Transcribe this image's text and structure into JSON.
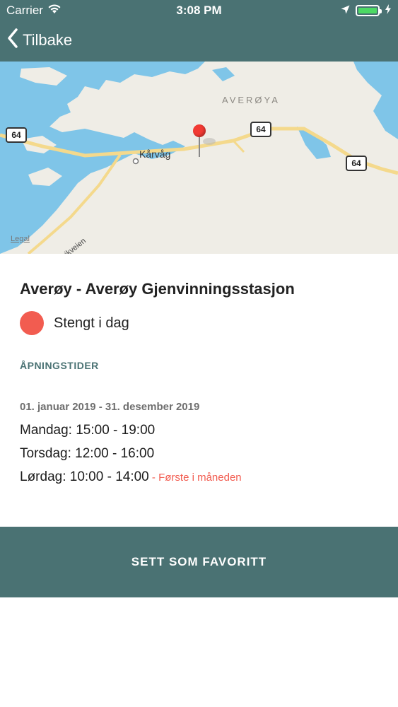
{
  "status_bar": {
    "carrier": "Carrier",
    "time": "3:08 PM"
  },
  "nav": {
    "back_label": "Tilbake"
  },
  "map": {
    "region_label": "AVERØYA",
    "place_label": "Kårvåg",
    "road_name": "Tøvikveien",
    "road_shields": [
      "64",
      "64",
      "64"
    ],
    "legal_label": "Legal"
  },
  "station": {
    "title": "Averøy - Averøy Gjenvinningsstasjon",
    "status": "Stengt i dag",
    "status_color": "#f25c50"
  },
  "opening_hours": {
    "heading": "ÅPNINGSTIDER",
    "period": "01. januar 2019 - 31. desember 2019",
    "days": [
      {
        "text": "Mandag: 15:00 - 19:00",
        "note": ""
      },
      {
        "text": "Torsdag: 12:00 - 16:00",
        "note": ""
      },
      {
        "text": "Lørdag: 10:00 - 14:00",
        "note": " - Første i måneden"
      }
    ]
  },
  "actions": {
    "favorite_label": "SETT SOM FAVORITT"
  },
  "colors": {
    "brand": "#4a7273",
    "water": "#7fc5e8",
    "land": "#efede6",
    "road": "#f4d98c"
  }
}
